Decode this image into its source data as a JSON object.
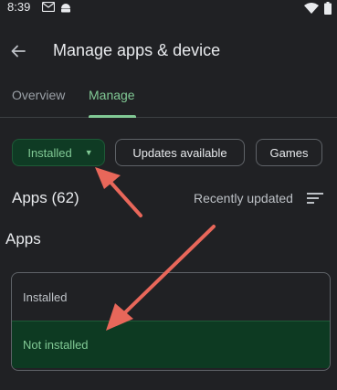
{
  "status_bar": {
    "time": "8:39",
    "left_icons": [
      "gmail-icon",
      "android-icon"
    ],
    "right_icons": [
      "wifi-icon",
      "battery-icon"
    ]
  },
  "app_bar": {
    "back_icon": "arrow-left-icon",
    "title": "Manage apps & device"
  },
  "tabs": [
    {
      "label": "Overview",
      "selected": false
    },
    {
      "label": "Manage",
      "selected": true
    }
  ],
  "filter_chips": {
    "installed": "Installed",
    "installed_icon": "caret-down-icon",
    "updates": "Updates available",
    "games": "Games"
  },
  "apps_header": {
    "count_label": "Apps (62)",
    "sort_label": "Recently updated",
    "sort_icon": "sort-icon"
  },
  "sheet": {
    "title": "Apps",
    "options": [
      {
        "label": "Installed",
        "selected": false
      },
      {
        "label": "Not installed",
        "selected": true
      }
    ]
  },
  "colors": {
    "background": "#202124",
    "accent": "#81c995",
    "selected_bg": "#0d3a22",
    "annotation_arrow": "#e8675a"
  }
}
